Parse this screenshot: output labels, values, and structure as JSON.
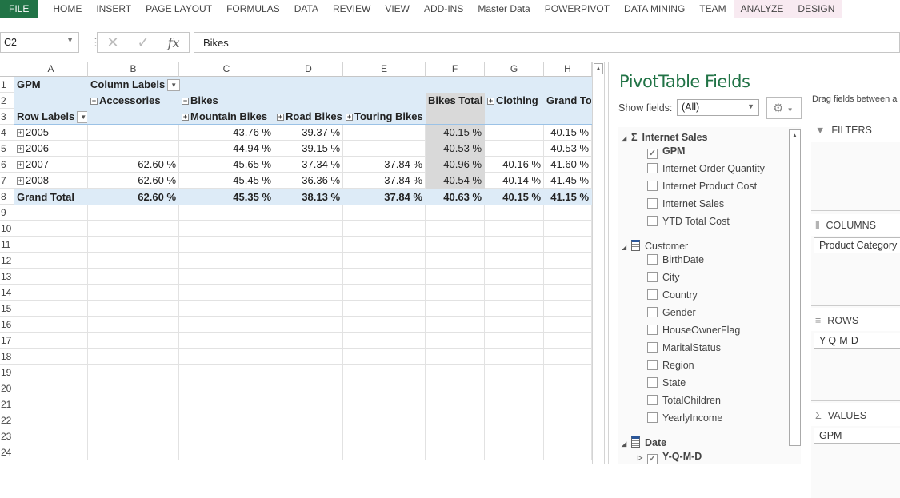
{
  "ribbon": {
    "tabs": [
      "FILE",
      "HOME",
      "INSERT",
      "PAGE LAYOUT",
      "FORMULAS",
      "DATA",
      "REVIEW",
      "VIEW",
      "ADD-INS",
      "Master Data",
      "POWERPIVOT",
      "DATA MINING",
      "TEAM",
      "ANALYZE",
      "DESIGN"
    ]
  },
  "formula_bar": {
    "name_box": "C2",
    "value": "Bikes",
    "fx": "fx"
  },
  "columns": [
    "A",
    "B",
    "C",
    "D",
    "E",
    "F",
    "G",
    "H"
  ],
  "rows": [
    "1",
    "2",
    "3",
    "4",
    "5",
    "6",
    "7",
    "8",
    "9",
    "10",
    "11",
    "12",
    "13",
    "14",
    "15",
    "16",
    "17",
    "18",
    "19",
    "20",
    "21",
    "22",
    "23",
    "24"
  ],
  "pivot": {
    "measure": "GPM",
    "column_labels": "Column Labels",
    "row_labels": "Row Labels",
    "accessories": "Accessories",
    "bikes": "Bikes",
    "mountain": "Mountain Bikes",
    "road": "Road Bikes",
    "touring": "Touring Bikes",
    "bikes_total": "Bikes Total",
    "clothing": "Clothing",
    "grand_total_col": "Grand Total",
    "data_rows": [
      {
        "label": "2005",
        "values": [
          "",
          "43.76 %",
          "39.37 %",
          "",
          "40.15 %",
          "",
          "40.15 %"
        ]
      },
      {
        "label": "2006",
        "values": [
          "",
          "44.94 %",
          "39.15 %",
          "",
          "40.53 %",
          "",
          "40.53 %"
        ]
      },
      {
        "label": "2007",
        "values": [
          "62.60 %",
          "45.65 %",
          "37.34 %",
          "37.84 %",
          "40.96 %",
          "40.16 %",
          "41.60 %"
        ]
      },
      {
        "label": "2008",
        "values": [
          "62.60 %",
          "45.45 %",
          "36.36 %",
          "37.84 %",
          "40.54 %",
          "40.14 %",
          "41.45 %"
        ]
      }
    ],
    "grand_total": {
      "label": "Grand Total",
      "values": [
        "62.60 %",
        "45.35 %",
        "38.13 %",
        "37.84 %",
        "40.63 %",
        "40.15 %",
        "41.15 %"
      ]
    }
  },
  "pane": {
    "title": "PivotTable Fields",
    "show_fields_label": "Show fields:",
    "show_fields_value": "(All)",
    "drag_text": "Drag fields between a",
    "groups": [
      {
        "name": "Internet Sales",
        "type": "measure",
        "fields": [
          {
            "name": "GPM",
            "checked": true
          },
          {
            "name": "Internet Order Quantity",
            "checked": false
          },
          {
            "name": "Internet Product Cost",
            "checked": false
          },
          {
            "name": "Internet Sales",
            "checked": false
          },
          {
            "name": "YTD Total Cost",
            "checked": false
          }
        ]
      },
      {
        "name": "Customer",
        "type": "table",
        "fields": [
          {
            "name": "BirthDate",
            "checked": false
          },
          {
            "name": "City",
            "checked": false
          },
          {
            "name": "Country",
            "checked": false
          },
          {
            "name": "Gender",
            "checked": false
          },
          {
            "name": "HouseOwnerFlag",
            "checked": false
          },
          {
            "name": "MaritalStatus",
            "checked": false
          },
          {
            "name": "Region",
            "checked": false
          },
          {
            "name": "State",
            "checked": false
          },
          {
            "name": "TotalChildren",
            "checked": false
          },
          {
            "name": "YearlyIncome",
            "checked": false
          }
        ]
      },
      {
        "name": "Date",
        "type": "table",
        "fields": [
          {
            "name": "Y-Q-M-D",
            "checked": true
          }
        ]
      }
    ],
    "areas": {
      "filters": "FILTERS",
      "columns": "COLUMNS",
      "columns_item": "Product Category",
      "rows": "ROWS",
      "rows_item": "Y-Q-M-D",
      "values": "VALUES",
      "values_item": "GPM"
    }
  }
}
